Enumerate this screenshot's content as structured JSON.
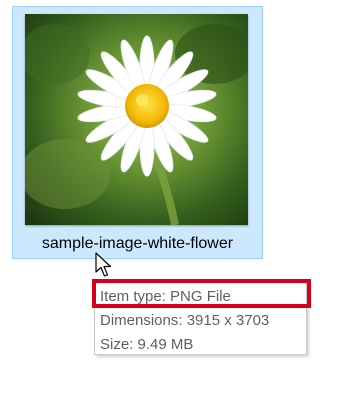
{
  "file": {
    "name": "sample-image-white-flower",
    "selected": true,
    "thumbnail_icon": "flower-photo-thumbnail"
  },
  "tooltip": {
    "item_type": "Item type: PNG File",
    "dimensions": "Dimensions: 3915 x 3703",
    "size": "Size: 9.49 MB"
  },
  "colors": {
    "selection_fill": "#cce8ff",
    "selection_border": "#99d1ff",
    "highlight": "#d6001c",
    "tooltip_text": "#5f5f5f"
  },
  "cursor": "arrow-pointer-icon"
}
